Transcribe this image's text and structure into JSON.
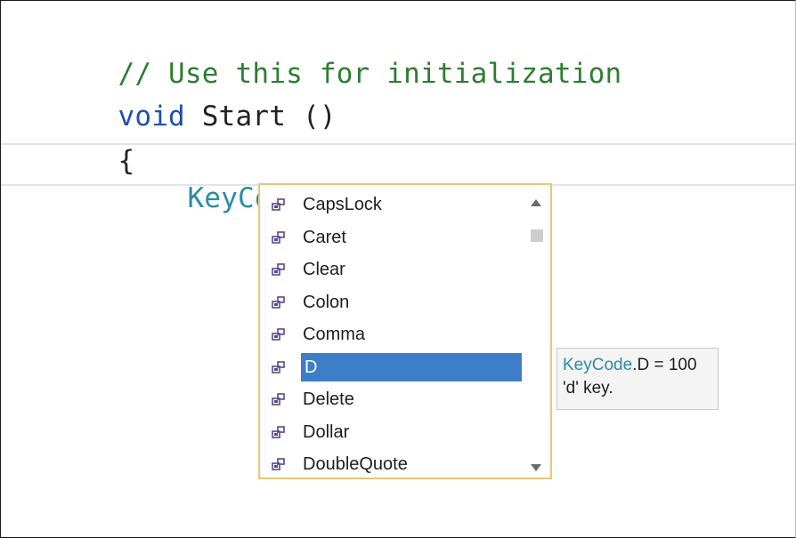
{
  "editor": {
    "comment_line": "// Use this for initialization",
    "method_keyword": "void",
    "method_name": " Start ()",
    "open_brace": "{",
    "current_type": "KeyCode",
    "current_dot": "."
  },
  "completion": {
    "items": [
      {
        "label": "CapsLock",
        "icon": "enum-member-icon"
      },
      {
        "label": "Caret",
        "icon": "enum-member-icon"
      },
      {
        "label": "Clear",
        "icon": "enum-member-icon"
      },
      {
        "label": "Colon",
        "icon": "enum-member-icon"
      },
      {
        "label": "Comma",
        "icon": "enum-member-icon"
      },
      {
        "label": "D",
        "icon": "enum-member-icon",
        "selected": true
      },
      {
        "label": "Delete",
        "icon": "enum-member-icon"
      },
      {
        "label": "Dollar",
        "icon": "enum-member-icon"
      },
      {
        "label": "DoubleQuote",
        "icon": "enum-member-icon"
      }
    ],
    "selected_index": 5
  },
  "tooltip": {
    "type_name": "KeyCode",
    "member_value": ".D = 100",
    "description": "'d' key."
  },
  "colors": {
    "comment": "#2e7d32",
    "keyword": "#1f4fb0",
    "type": "#2b8aa8",
    "selection": "#3d7ec8",
    "popup_border": "#e8c77a"
  }
}
